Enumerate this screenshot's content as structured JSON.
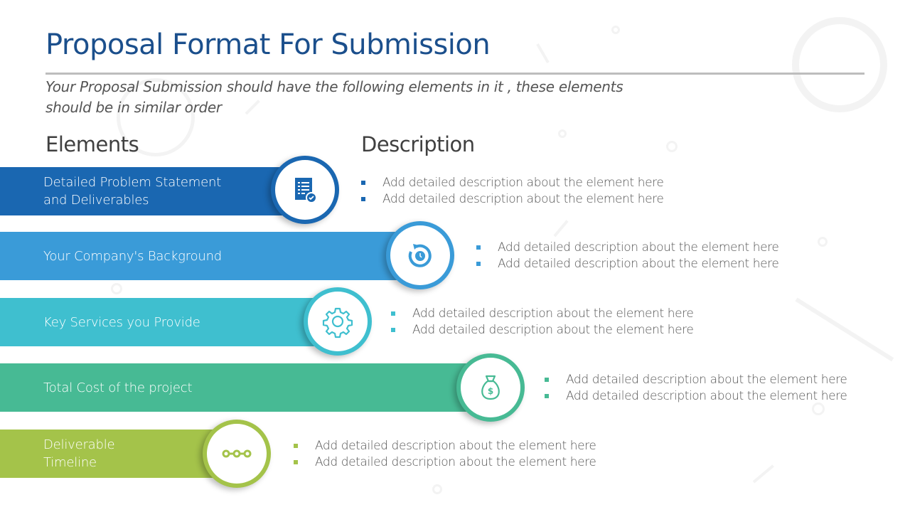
{
  "slide": {
    "title": "Proposal Format For Submission",
    "subtitle": "Your Proposal Submission should have the following elements in it , these elements should be in similar order",
    "columns": {
      "elements": "Elements",
      "description": "Description"
    }
  },
  "rows": [
    {
      "label": "Detailed Problem Statement and Deliverables",
      "icon": "document-check-icon",
      "color": "#1a67b1",
      "bullets": [
        "Add detailed description about the element here",
        "Add detailed description about the element here"
      ]
    },
    {
      "label": "Your Company's Background",
      "icon": "history-clock-icon",
      "color": "#3a9bd8",
      "bullets": [
        "Add detailed description about the element here",
        "Add detailed description about the element here"
      ]
    },
    {
      "label": "Key Services you Provide",
      "icon": "gear-icon",
      "color": "#3fbfcf",
      "bullets": [
        "Add detailed description about the element here",
        "Add detailed description about the element here"
      ]
    },
    {
      "label": "Total Cost of the project",
      "icon": "money-bag-icon",
      "color": "#47ba94",
      "bullets": [
        "Add detailed description about the element here",
        "Add detailed description about the element here"
      ]
    },
    {
      "label": "Deliverable Timeline",
      "icon": "timeline-icon",
      "color": "#a4c34a",
      "bullets": [
        "Add detailed description about the element here",
        "Add detailed description about the element here"
      ]
    }
  ]
}
